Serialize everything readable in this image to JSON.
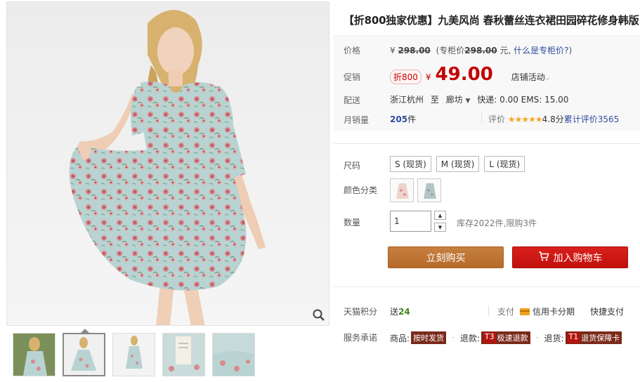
{
  "product": {
    "title": "【折800独家优惠】九美风尚 春秋蕾丝连衣裙田园碎花修身韩版"
  },
  "price": {
    "orig_label": "价格",
    "orig_currency": "¥",
    "orig_price": "298.00",
    "counter_note_prefix": "(专柜价",
    "counter_price": "298.00",
    "counter_note_suffix": "元,",
    "counter_link": "什么是专柜价?",
    "close_paren": ")",
    "promo_label": "促销",
    "promo_tag": "折800",
    "promo_currency": "¥",
    "promo_price": "49.00",
    "store_activity": "店铺活动",
    "ship_label": "配送",
    "ship_from": "浙江杭州",
    "ship_to_word": "至",
    "ship_to": "廊坊",
    "ship_fees": "快递: 0.00 EMS: 15.00",
    "sales_label": "月销量",
    "sales_count": "205",
    "sales_unit": "件",
    "rating_label": "评价",
    "rating_stars": "★★★★★",
    "rating_score": "4.8分",
    "rating_count": "累计评价3565"
  },
  "options": {
    "size_label": "尺码",
    "sizes": [
      "S (现货)",
      "M (现货)",
      "L (现货)"
    ],
    "color_label": "颜色分类",
    "qty_label": "数量",
    "qty_value": "1",
    "stock_text": "库存2022件,限购3件"
  },
  "actions": {
    "buy_now": "立刻购买",
    "add_to_cart": "加入购物车"
  },
  "extras": {
    "points_label": "天猫积分",
    "points_prefix": "送",
    "points_value": "24",
    "pay_label": "支付",
    "credit_installment": "信用卡分期",
    "quick_pay": "快捷支付",
    "service_label": "服务承诺",
    "services": [
      {
        "prefix": "商品:",
        "code": "",
        "text": "按时发货"
      },
      {
        "prefix": "退款:",
        "code": "T3",
        "text": "极速退款"
      },
      {
        "prefix": "退货:",
        "code": "T1",
        "text": "退货保障卡"
      }
    ]
  },
  "colors": {
    "promo_red": "#c40000",
    "buy_orange": "#b56a2a",
    "cart_red": "#c2100c",
    "link_blue": "#2b4c9a"
  },
  "icons": {
    "zoom": "magnifier-icon",
    "cart": "cart-icon",
    "chevron": "chevron-down-icon",
    "card": "credit-card-icon"
  }
}
